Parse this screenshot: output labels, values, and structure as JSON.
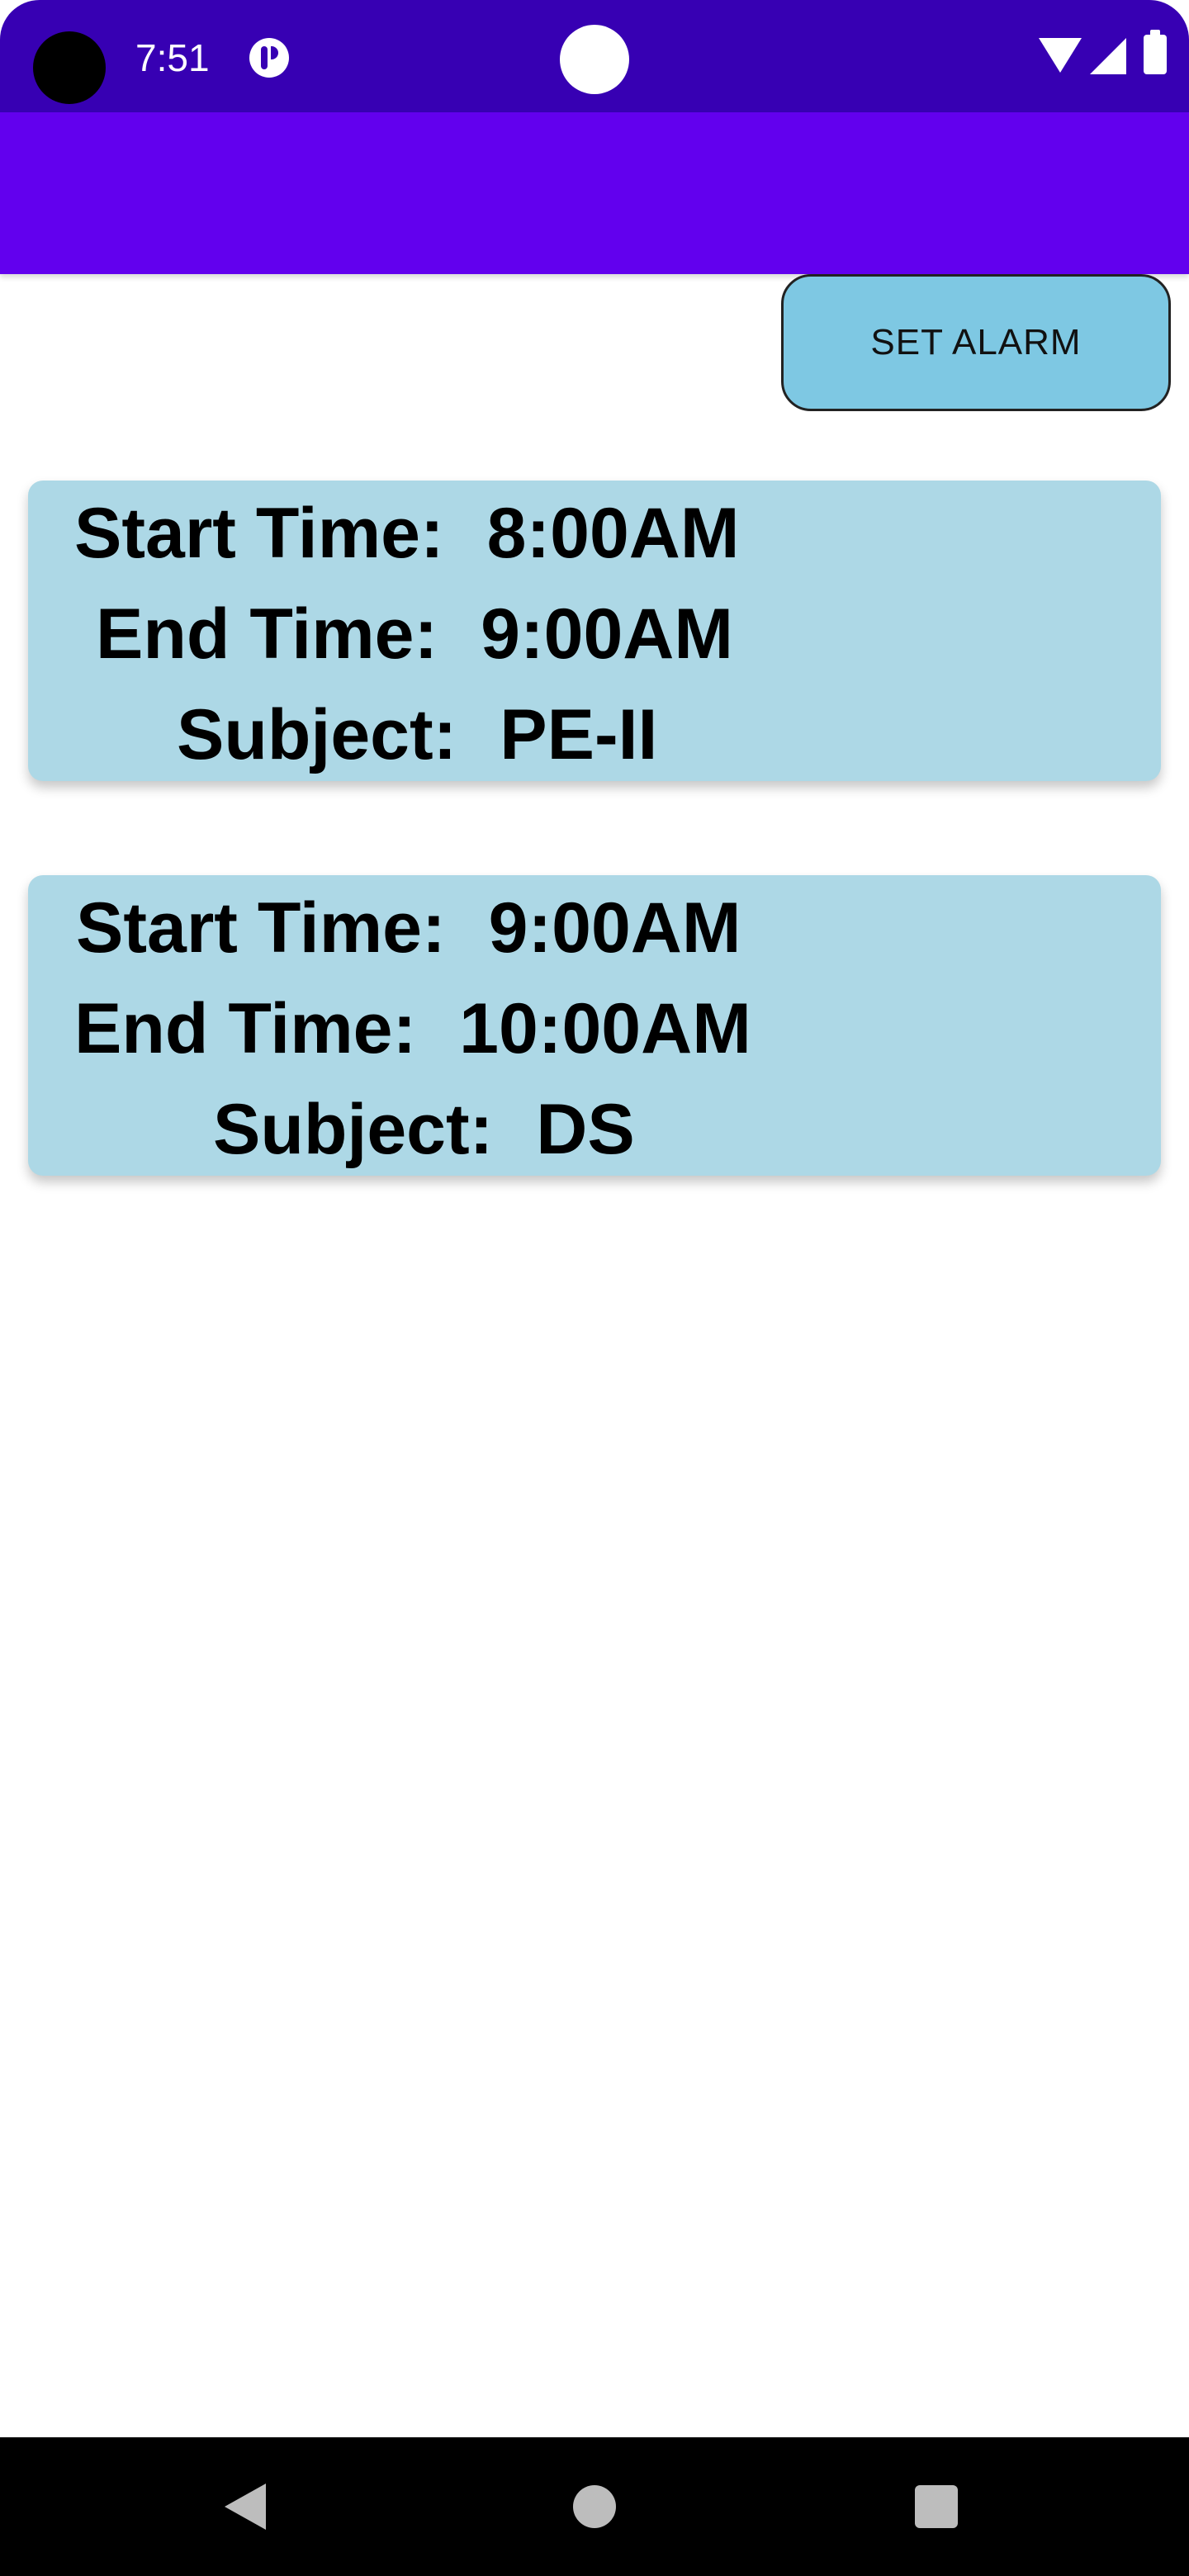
{
  "status_bar": {
    "time": "7:51"
  },
  "actions": {
    "set_alarm_label": "SET ALARM"
  },
  "schedule": [
    {
      "start_label": "Start Time:",
      "start_value": "8:00AM",
      "end_label": "End Time:",
      "end_value": "9:00AM",
      "subject_label": "Subject:",
      "subject_value": "PE-II"
    },
    {
      "start_label": "Start Time:",
      "start_value": "9:00AM",
      "end_label": "End Time:",
      "end_value": "10:00AM",
      "subject_label": "Subject:",
      "subject_value": "DS"
    }
  ],
  "colors": {
    "status_bar": "#3700B3",
    "app_bar": "#6200EE",
    "card": "#ADD8E6",
    "button": "#7EC8E3"
  },
  "icons": {
    "status": [
      "camera-hole",
      "app-notification-icon",
      "wifi-icon",
      "signal-icon",
      "battery-icon"
    ],
    "navigation": [
      "back-icon",
      "home-icon",
      "recents-icon"
    ]
  }
}
